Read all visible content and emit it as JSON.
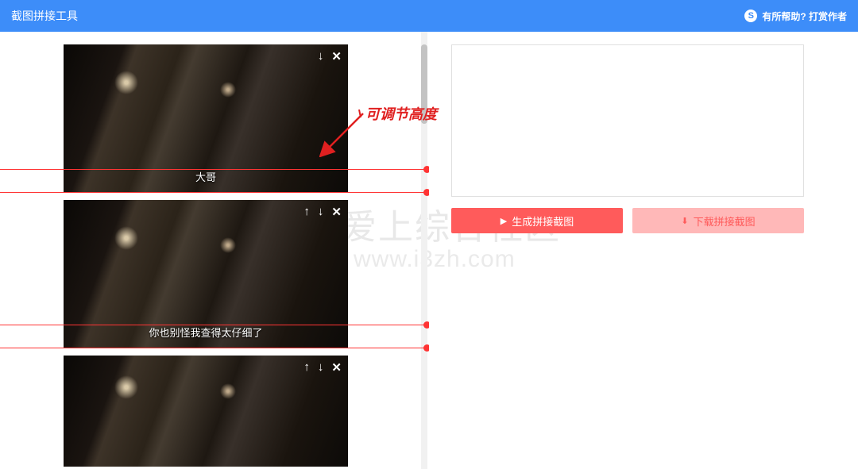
{
  "header": {
    "title": "截图拼接工具",
    "tip_label": "有所帮助? 打赏作者"
  },
  "thumbs": [
    {
      "subtitle": "大哥",
      "controls": {
        "up": false,
        "down": true,
        "close": true
      }
    },
    {
      "subtitle": "你也别怪我查得太仔细了",
      "controls": {
        "up": true,
        "down": true,
        "close": true
      }
    },
    {
      "subtitle": "",
      "controls": {
        "up": true,
        "down": true,
        "close": true
      }
    }
  ],
  "annotation": "可调节高度",
  "buttons": {
    "generate": "生成拼接截图",
    "download": "下载拼接截图"
  },
  "watermark": {
    "line1": "爱上综合社区",
    "line2": "www.i3zh.com"
  }
}
